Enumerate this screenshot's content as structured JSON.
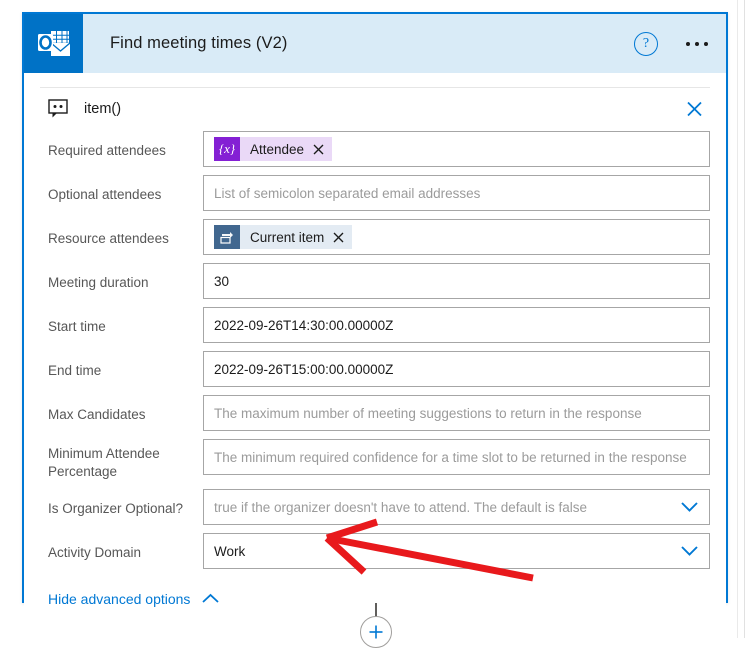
{
  "card": {
    "app_icon": "outlook-icon",
    "title": "Find meeting times (V2)",
    "help_icon": "help-circle-icon",
    "more_icon": "ellipsis-icon",
    "close_icon": "close-icon",
    "item_row": {
      "icon": "comment-bubble-icon",
      "label": "item()"
    },
    "fields": [
      {
        "label": "Required attendees",
        "type": "token",
        "token": {
          "badge": "{x}",
          "badge_kind": "expression",
          "text": "Attendee",
          "remove": "×"
        }
      },
      {
        "label": "Optional attendees",
        "type": "text",
        "placeholder": "List of semicolon separated email addresses",
        "value": ""
      },
      {
        "label": "Resource attendees",
        "type": "token",
        "token": {
          "badge": "loop-icon",
          "badge_kind": "current-item",
          "text": "Current item",
          "remove": "×"
        }
      },
      {
        "label": "Meeting duration",
        "type": "text",
        "placeholder": "",
        "value": "30"
      },
      {
        "label": "Start time",
        "type": "text",
        "placeholder": "",
        "value": "2022-09-26T14:30:00.00000Z"
      },
      {
        "label": "End time",
        "type": "text",
        "placeholder": "",
        "value": "2022-09-26T15:00:00.00000Z"
      },
      {
        "label": "Max Candidates",
        "type": "text",
        "placeholder": "The maximum number of meeting suggestions to return in the response",
        "value": ""
      },
      {
        "label": "Minimum Attendee Percentage",
        "type": "text",
        "placeholder": "The minimum required confidence for a time slot to be returned in the response",
        "value": ""
      },
      {
        "label": "Is Organizer Optional?",
        "type": "dropdown",
        "placeholder": "true if the organizer doesn't have to attend. The default is false",
        "value": ""
      },
      {
        "label": "Activity Domain",
        "type": "dropdown",
        "placeholder": "",
        "value": "Work"
      }
    ],
    "advanced_toggle": {
      "label": "Hide advanced options",
      "icon": "chevron-up-icon"
    }
  },
  "canvas": {
    "add_step_icon": "plus-icon"
  },
  "annotation": {
    "arrow_color": "#e8191c",
    "points_at": "Activity Domain"
  },
  "colors": {
    "accent": "#0078d4",
    "header_bg": "#d9ebf7",
    "app_icon_bg": "#0072c6",
    "expression_purple": "#8420d4",
    "expression_bg": "#ead9f7",
    "loop_blue": "#41678f",
    "loop_bg": "#e3ebf3",
    "annotation_red": "#e8191c"
  }
}
